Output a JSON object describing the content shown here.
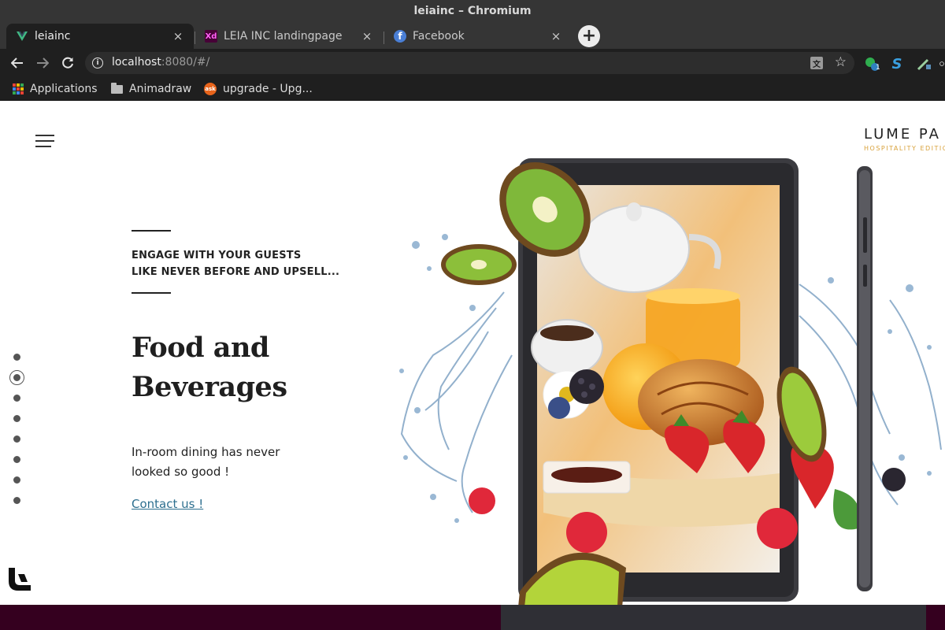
{
  "window": {
    "title": "leiainc – Chromium"
  },
  "tabs": [
    {
      "title": "leiainc",
      "icon": "vue-icon",
      "active": true
    },
    {
      "title": "LEIA INC landingpage",
      "icon": "adobe-xd-icon",
      "active": false
    },
    {
      "title": "Facebook",
      "icon": "facebook-icon",
      "active": false
    }
  ],
  "tab_close_glyph": "×",
  "new_tab_glyph": "+",
  "toolbar": {
    "url_host": "localhost",
    "url_rest": ":8080/#/",
    "translate_glyph": "文",
    "badge_count": "1"
  },
  "bookmarks": [
    {
      "label": "Applications",
      "icon": "apps-grid-icon"
    },
    {
      "label": "Animadraw",
      "icon": "folder-icon"
    },
    {
      "label": "upgrade - Upg...",
      "icon": "ask-icon"
    }
  ],
  "brand": {
    "name": "LUME PA",
    "subtitle": "HOSPITALITY EDITIO"
  },
  "hero": {
    "tagline_line1": "ENGAGE WITH YOUR GUESTS",
    "tagline_line2": "LIKE NEVER BEFORE AND UPSELL...",
    "headline_line1": "Food and",
    "headline_line2": "Beverages",
    "body_line1": "In-room dining has never",
    "body_line2": "looked so good !",
    "cta": "Contact us !"
  },
  "pagination": {
    "total": 8,
    "active_index": 1
  },
  "colors": {
    "accent_gold": "#d8a13a",
    "link": "#2d6f8f",
    "footer_band": "#35001f",
    "chrome_dark": "#1f1f1f"
  }
}
